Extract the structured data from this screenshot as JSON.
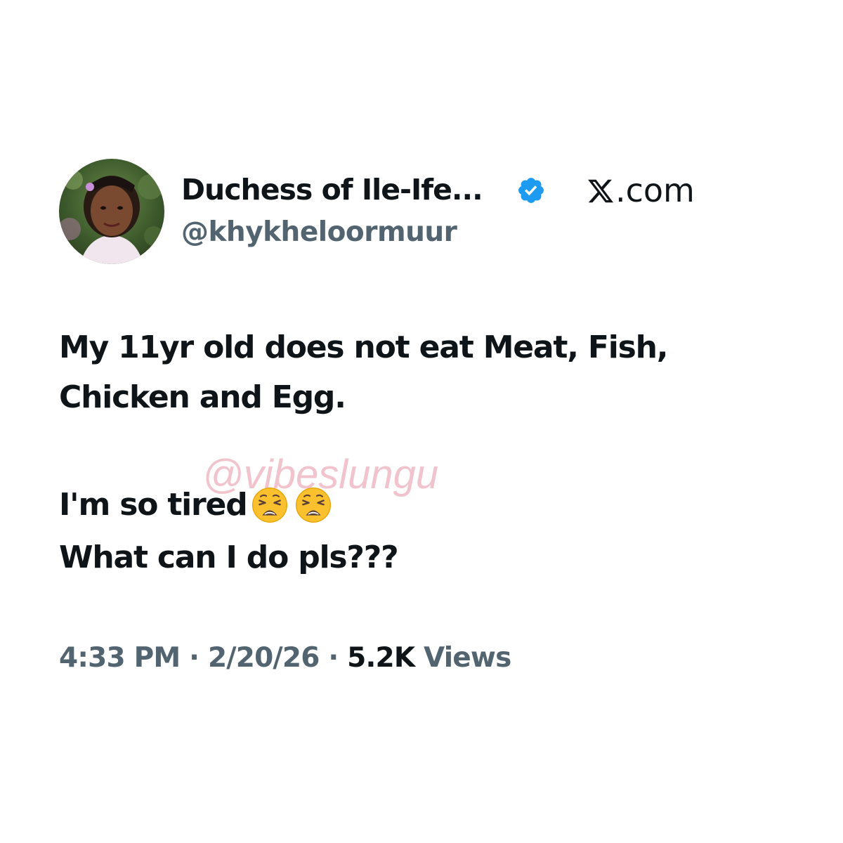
{
  "author": {
    "display_name": "Duchess of Ile-Ife...",
    "handle": "@khykheloormuur",
    "verified": true,
    "verified_badge_color": "#1d9bf0"
  },
  "brand": {
    "label": ".com",
    "icon": "x-logo-icon"
  },
  "tweet": {
    "lines": [
      "My 11yr old does not eat Meat, Fish,",
      "Chicken and Egg.",
      "I'm so tired",
      "What can I do pls???"
    ],
    "emojis": [
      "weary-face-icon",
      "weary-face-icon"
    ]
  },
  "watermark": {
    "text": "@vibeslungu",
    "color": "#ecb0bc"
  },
  "meta": {
    "time": "4:33 PM",
    "separator": "·",
    "date": "2/20/26",
    "views_count": "5.2K",
    "views_label": "Views"
  },
  "colors": {
    "text": "#0f1419",
    "secondary": "#536471",
    "background": "#ffffff"
  }
}
